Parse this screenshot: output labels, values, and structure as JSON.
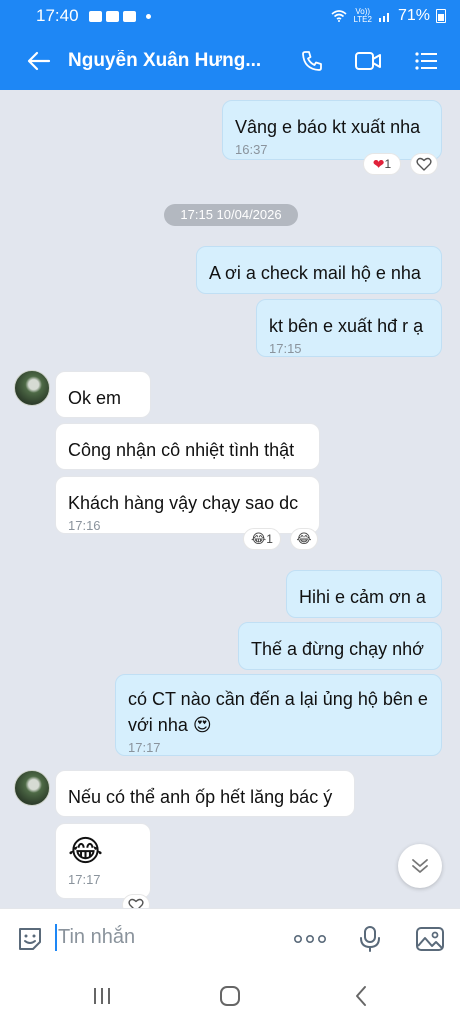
{
  "status_bar": {
    "time": "17:40",
    "network": "Vo))\nLTE2",
    "battery": "71%"
  },
  "header": {
    "title": "Nguyễn Xuân Hưng..."
  },
  "messages": [
    {
      "text": "Vâng e báo kt xuất nha",
      "time": "16:37",
      "reaction_count": "1"
    },
    {
      "date": "17:15 10/04/2026"
    },
    {
      "text": "A ơi a check mail hộ e nha"
    },
    {
      "text": "kt bên e xuất hđ r ạ",
      "time": "17:15"
    },
    {
      "text": "Ok em"
    },
    {
      "text": "Công nhận cô nhiệt tình thật"
    },
    {
      "text": "Khách hàng vậy chạy sao dc",
      "time": "17:16",
      "reaction_count": "1"
    },
    {
      "text": "Hihi e cảm ơn a"
    },
    {
      "text": "Thế a đừng chạy nhớ"
    },
    {
      "text": "có CT nào cần đến a lại ủng hộ bên e với nha 😍",
      "time": "17:17"
    },
    {
      "text": "Nếu có thể anh ốp hết lăng bác ý"
    },
    {
      "text": "😂",
      "time": "17:17"
    }
  ],
  "input": {
    "placeholder": "Tin nhắn"
  },
  "colors": {
    "header": "#1e87f5",
    "outgoing_bubble": "#d6effd",
    "incoming_bubble": "#ffffff",
    "background": "#e2e6ee"
  }
}
